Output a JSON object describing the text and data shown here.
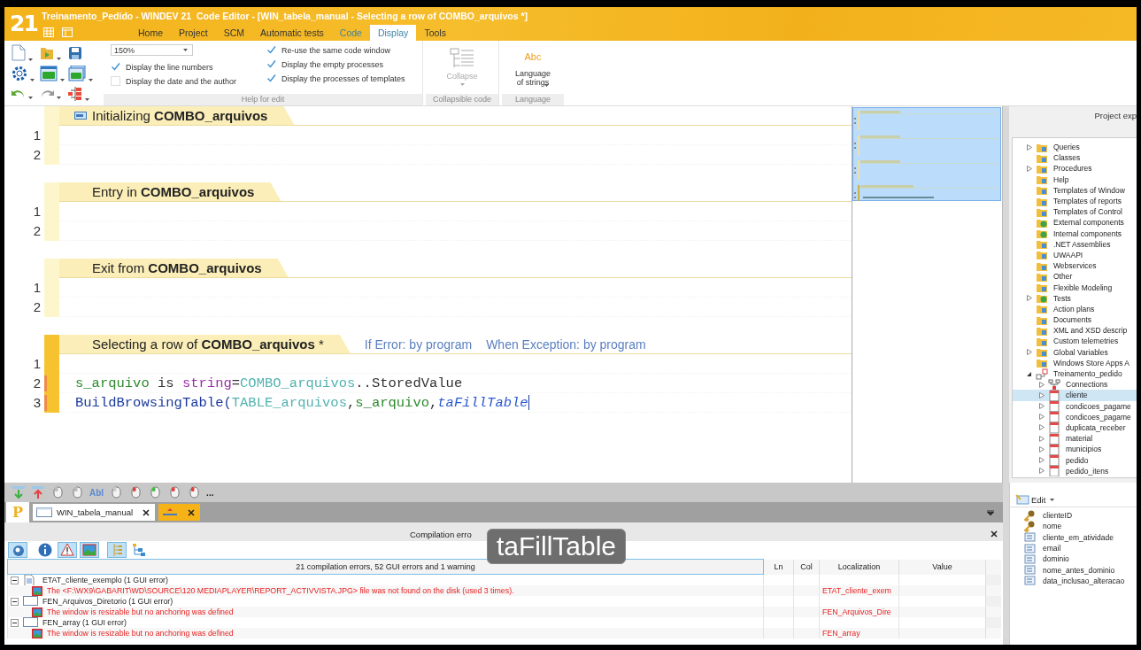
{
  "window": {
    "logo": "21",
    "title": "Treinamento_Pedido - WINDEV 21  Code Editor - [WIN_tabela_manual - Selecting a row of COMBO_arquivos *]"
  },
  "ribbon_tabs": [
    {
      "label": "Home",
      "selected": false,
      "contextual": false
    },
    {
      "label": "Project",
      "selected": false,
      "contextual": false
    },
    {
      "label": "SCM",
      "selected": false,
      "contextual": false
    },
    {
      "label": "Automatic tests",
      "selected": false,
      "contextual": false
    },
    {
      "label": "Code",
      "selected": false,
      "contextual": true
    },
    {
      "label": "Display",
      "selected": true,
      "contextual": false
    },
    {
      "label": "Tools",
      "selected": false,
      "contextual": false
    }
  ],
  "ribbon": {
    "zoom": "150%",
    "line_options": [
      {
        "label": "Display the line numbers",
        "checked": true
      },
      {
        "label": "Display the date and the author",
        "checked": false
      }
    ],
    "window_options": [
      {
        "label": "Re-use the same code window",
        "checked": true
      },
      {
        "label": "Display the empty processes",
        "checked": true
      },
      {
        "label": "Display the processes of templates",
        "checked": true
      }
    ],
    "collapse_button": {
      "label": "Collapse",
      "disabled": true
    },
    "language_button": {
      "icon_text": "Abc",
      "label": "Language of strings"
    },
    "groups": [
      "Help for edit",
      "Collapsible code",
      "Language"
    ]
  },
  "code_sections": [
    {
      "title": "Initializing **COMBO_arquivos**",
      "has_icon": true,
      "current": false,
      "lines": [
        {
          "number": "1"
        },
        {
          "number": "2"
        }
      ]
    },
    {
      "title": "Entry in **COMBO_arquivos**",
      "has_icon": false,
      "current": false,
      "lines": [
        {
          "number": "1"
        },
        {
          "number": "2"
        }
      ]
    },
    {
      "title": "Exit from **COMBO_arquivos**",
      "has_icon": false,
      "current": false,
      "lines": [
        {
          "number": "1"
        },
        {
          "number": "2"
        }
      ]
    },
    {
      "title": "Selecting a row of **COMBO_arquivos** *",
      "has_icon": false,
      "current": true,
      "annotations": [
        "If Error: by program",
        "When Exception: by program"
      ],
      "lines": [
        {
          "number": "1"
        },
        {
          "number": "2",
          "modified": true,
          "tokens": [
            {
              "text": "s_arquivo",
              "kind": "variable"
            },
            {
              "text": " is ",
              "kind": "keyword"
            },
            {
              "text": "string",
              "kind": "type"
            },
            {
              "text": "=",
              "kind": "plain"
            },
            {
              "text": "COMBO_arquivos",
              "kind": "control"
            },
            {
              "text": "..StoredValue",
              "kind": "plain"
            }
          ]
        },
        {
          "number": "3",
          "modified": true,
          "caret": true,
          "tokens": [
            {
              "text": "BuildBrowsingTable(",
              "kind": "function"
            },
            {
              "text": "TABLE_arquivos",
              "kind": "control"
            },
            {
              "text": ",",
              "kind": "plain"
            },
            {
              "text": "s_arquivo",
              "kind": "variable"
            },
            {
              "text": ",",
              "kind": "plain"
            },
            {
              "text": "taFillTable",
              "kind": "constant"
            }
          ]
        }
      ]
    }
  ],
  "project_explorer": {
    "title": "Project exp",
    "items": [
      {
        "label": "Queries",
        "kind": "folder",
        "expanded": false,
        "selected": false
      },
      {
        "label": "Classes",
        "kind": "folder",
        "selected": false
      },
      {
        "label": "Procedures",
        "kind": "folder",
        "expanded": false,
        "selected": false
      },
      {
        "label": "Help",
        "kind": "folder",
        "selected": false
      },
      {
        "label": "Templates of Window",
        "kind": "folder",
        "selected": false
      },
      {
        "label": "Templates of reports",
        "kind": "folder",
        "selected": false
      },
      {
        "label": "Templates of Control",
        "kind": "folder",
        "selected": false
      },
      {
        "label": "External components",
        "kind": "component",
        "selected": false
      },
      {
        "label": "Internal components",
        "kind": "component",
        "selected": false
      },
      {
        "label": ".NET Assemblies",
        "kind": "folder",
        "selected": false
      },
      {
        "label": "UWAAPI",
        "kind": "folder",
        "selected": false
      },
      {
        "label": "Webservices",
        "kind": "folder",
        "selected": false
      },
      {
        "label": "Other",
        "kind": "folder",
        "selected": false
      },
      {
        "label": "Flexible Modeling",
        "kind": "folder",
        "selected": false
      },
      {
        "label": "Tests",
        "kind": "component",
        "expanded": false,
        "selected": false
      },
      {
        "label": "Action plans",
        "kind": "folder",
        "selected": false
      },
      {
        "label": "Documents",
        "kind": "folder",
        "selected": false
      },
      {
        "label": "XML and XSD descrip",
        "kind": "folder",
        "selected": false
      },
      {
        "label": "Custom telemetries",
        "kind": "folder",
        "selected": false
      },
      {
        "label": "Global Variables",
        "kind": "folder",
        "expanded": false,
        "selected": false
      },
      {
        "label": "Windows Store Apps A",
        "kind": "folder",
        "selected": false
      },
      {
        "label": "Treinamento_pedido",
        "kind": "analysis",
        "expanded": true,
        "selected": false,
        "children": [
          {
            "label": "Connections",
            "kind": "connections",
            "expanded": false,
            "selected": false
          },
          {
            "label": "cliente",
            "kind": "table",
            "expanded": false,
            "selected": true
          },
          {
            "label": "condicoes_pagame",
            "kind": "table",
            "expanded": false,
            "selected": false
          },
          {
            "label": "condicoes_pagame",
            "kind": "table",
            "expanded": false,
            "selected": false
          },
          {
            "label": "duplicata_receber",
            "kind": "table",
            "expanded": false,
            "selected": false
          },
          {
            "label": "material",
            "kind": "table",
            "expanded": false,
            "selected": false
          },
          {
            "label": "municipios",
            "kind": "table",
            "expanded": false,
            "selected": false
          },
          {
            "label": "pedido",
            "kind": "table",
            "expanded": false,
            "selected": false
          },
          {
            "label": "pedido_itens",
            "kind": "table",
            "expanded": false,
            "selected": false
          }
        ]
      }
    ]
  },
  "field_panel": {
    "edit_button": "Edit",
    "fields": [
      {
        "name": "clienteID",
        "kind": "key"
      },
      {
        "name": "nome",
        "kind": "key"
      },
      {
        "name": "cliente_em_atividade",
        "kind": "field"
      },
      {
        "name": "email",
        "kind": "field"
      },
      {
        "name": "dominio",
        "kind": "field"
      },
      {
        "name": "nome_antes_dominio",
        "kind": "field"
      },
      {
        "name": "data_inclusao_alteracao",
        "kind": "field"
      }
    ]
  },
  "debug_toolbar": {
    "text_icon": "AbI",
    "more": "..."
  },
  "document_tabs": {
    "logo": "P",
    "tabs": [
      {
        "label": "WIN_tabela_manual",
        "kind": "window",
        "selected": false
      },
      {
        "kind": "code",
        "selected": true
      }
    ]
  },
  "error_panel": {
    "title": "Compilation erro",
    "toolbar": [
      {
        "kind": "search",
        "on": true
      },
      {
        "kind": "info",
        "on": false
      },
      {
        "kind": "warning",
        "on": true
      },
      {
        "kind": "image",
        "on": true
      },
      {
        "kind": "tree",
        "on": true
      },
      {
        "kind": "hierarchy",
        "on": false
      }
    ],
    "columns": [
      "21 compilation errors, 52 GUI errors and 1 warning",
      "Ln",
      "Col",
      "Localization",
      "Value"
    ],
    "groups": [
      {
        "label": "ETAT_cliente_exemplo (1 GUI error)",
        "kind": "report",
        "expanded": true,
        "children": [
          {
            "message": "The <F:\\WX9\\GABARIT\\WD\\SOURCE\\120 MEDIAPLAYER\\REPORT_ACTIVVISTA.JPG> file was not found on the disk (used 3 times).",
            "localization": "ETAT_cliente_exem"
          }
        ]
      },
      {
        "label": "FEN_Arquivos_Diretorio (1 GUI error)",
        "kind": "window",
        "expanded": true,
        "children": [
          {
            "message": "The window is resizable but no anchoring was defined",
            "localization": "FEN_Arquivos_Dire"
          }
        ]
      },
      {
        "label": "FEN_array (1 GUI error)",
        "kind": "window",
        "expanded": true,
        "children": [
          {
            "message": "The window is resizable but no anchoring was defined",
            "localization": "FEN_array"
          }
        ]
      }
    ]
  },
  "overlay_caption": "taFillTable"
}
